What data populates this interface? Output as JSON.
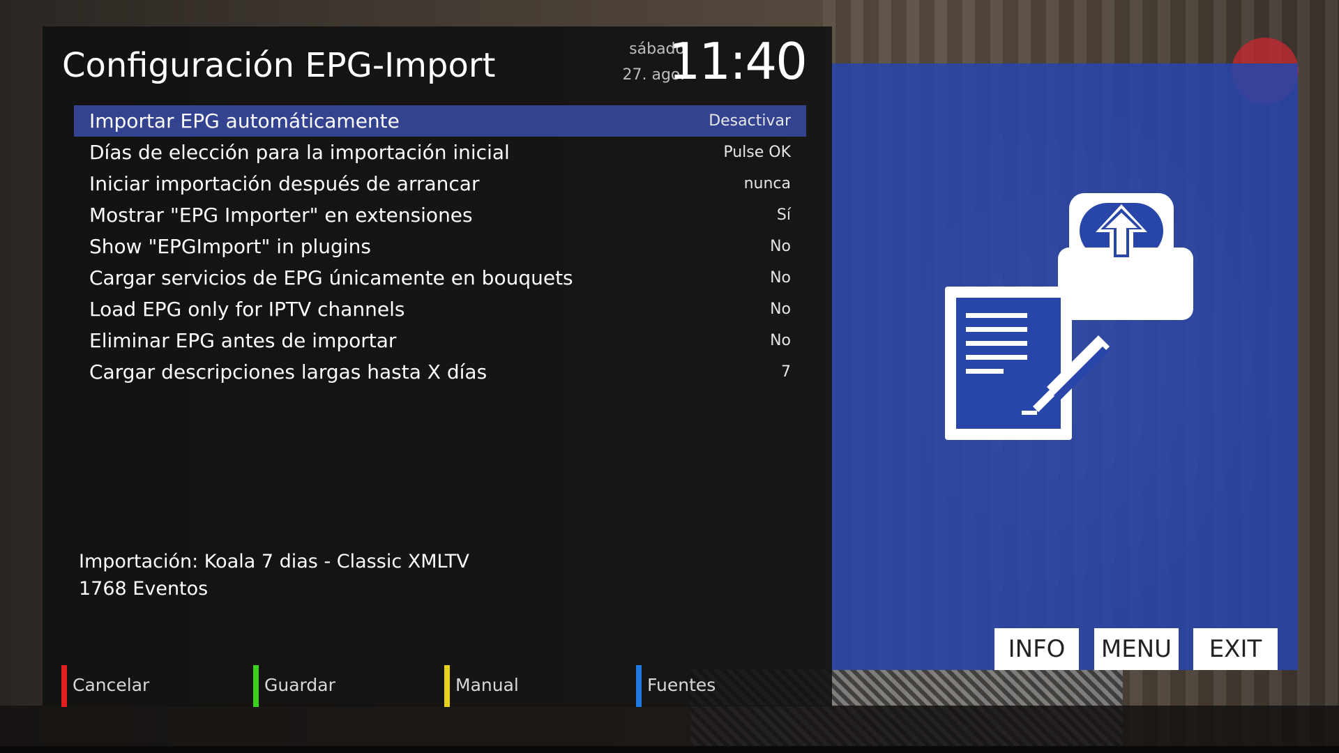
{
  "header": {
    "title": "Configuración EPG-Import",
    "day": "sábado",
    "date": "27. ago.",
    "time": "11:40"
  },
  "settings": [
    {
      "label": "Importar EPG automáticamente",
      "value": "Desactivar",
      "selected": true
    },
    {
      "label": "Días de elección para la importación inicial",
      "value": "Pulse OK",
      "selected": false
    },
    {
      "label": "Iniciar importación después de arrancar",
      "value": "nunca",
      "selected": false
    },
    {
      "label": "Mostrar \"EPG Importer\" en extensiones",
      "value": "Sí",
      "selected": false
    },
    {
      "label": "Show \"EPGImport\" in plugins",
      "value": "No",
      "selected": false
    },
    {
      "label": "Cargar servicios de EPG únicamente en bouquets",
      "value": "No",
      "selected": false
    },
    {
      "label": "Load EPG only for IPTV channels",
      "value": "No",
      "selected": false
    },
    {
      "label": "Eliminar EPG antes de importar",
      "value": "No",
      "selected": false
    },
    {
      "label": "Cargar descripciones largas hasta X días",
      "value": "7",
      "selected": false
    }
  ],
  "status": {
    "import_source": "Importación: Koala 7 dias - Classic XMLTV",
    "events": "1768 Eventos"
  },
  "color_keys": [
    {
      "label": "Cancelar",
      "color": "#e02020"
    },
    {
      "label": "Guardar",
      "color": "#3ccf1e"
    },
    {
      "label": "Manual",
      "color": "#e6d21a"
    },
    {
      "label": "Fuentes",
      "color": "#1f78e0"
    }
  ],
  "hint_buttons": {
    "info": "INFO",
    "menu": "MENU",
    "exit": "EXIT"
  },
  "icons": {
    "plugin_icon": "epg-import-upload-document-icon"
  },
  "colors": {
    "selection": "#34438f",
    "side_panel": "#2846aa"
  }
}
